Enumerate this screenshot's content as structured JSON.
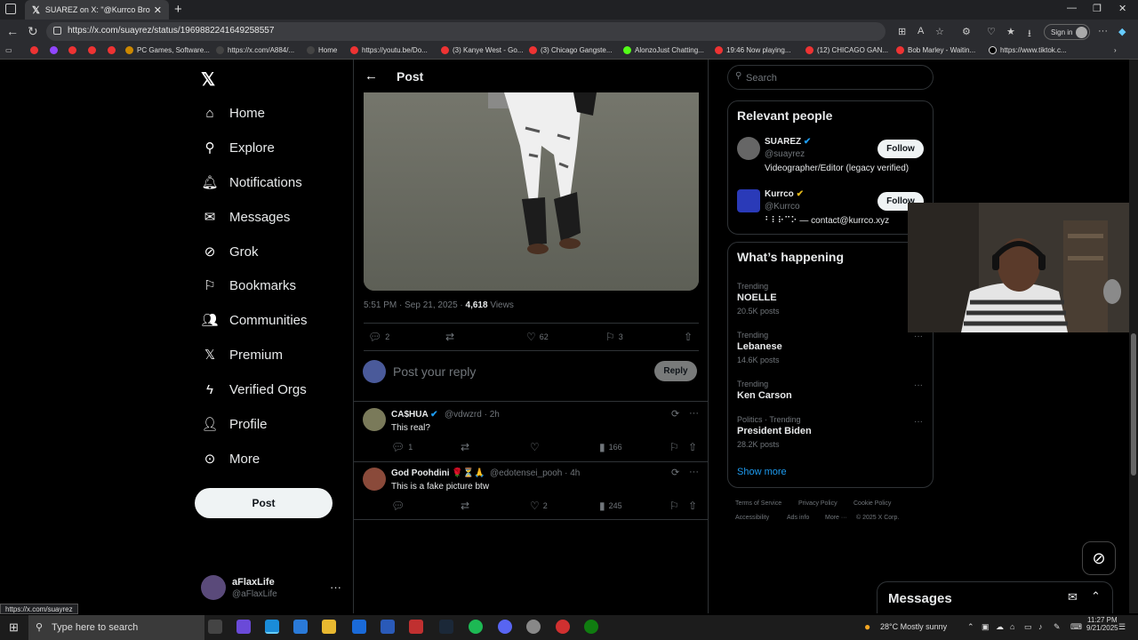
{
  "browser": {
    "tab_title": "SUAREZ on X: \"@Kurrco Bro neve",
    "url": "https://x.com/suayrez/status/1969882241649258557",
    "sign_in": "Sign in",
    "bookmarks": [
      "PC Games, Software...",
      "https://x.com/A884/...",
      "Home",
      "https://youtu.be/Do...",
      "(3) Kanye West - Go...",
      "(3) Chicago Gangste...",
      "AlonzoJust Chatting...",
      "19:46 Now playing...",
      "(12) CHICAGO GAN...",
      "Bob Marley - Waitin...",
      "https://www.tiktok.c..."
    ]
  },
  "sidebar": {
    "items": [
      {
        "label": "Home",
        "icon": "home-icon"
      },
      {
        "label": "Explore",
        "icon": "search-icon"
      },
      {
        "label": "Notifications",
        "icon": "bell-icon"
      },
      {
        "label": "Messages",
        "icon": "mail-icon"
      },
      {
        "label": "Grok",
        "icon": "grok-icon"
      },
      {
        "label": "Bookmarks",
        "icon": "bookmark-icon"
      },
      {
        "label": "Communities",
        "icon": "people-icon"
      },
      {
        "label": "Premium",
        "icon": "x-icon"
      },
      {
        "label": "Verified Orgs",
        "icon": "lightning-icon"
      },
      {
        "label": "Profile",
        "icon": "person-icon"
      },
      {
        "label": "More",
        "icon": "more-circle-icon"
      }
    ],
    "post_button": "Post",
    "account": {
      "name": "aFlaxLife",
      "handle": "@aFlaxLife"
    }
  },
  "main": {
    "header": "Post",
    "meta_time": "5:51 PM · Sep 21, 2025 · ",
    "views_count": "4,618",
    "views_label": " Views",
    "actions": {
      "replies": "2",
      "likes": "62",
      "bookmarks": "3"
    },
    "reply_placeholder": "Post your reply",
    "reply_button": "Reply",
    "replies": [
      {
        "name": "CA$HUA",
        "handle": "@vdwzrd · 2h",
        "text": "This real?",
        "replies": "1",
        "likes": "",
        "views": "166"
      },
      {
        "name": "God Poohdini 🌹⏳🙏",
        "handle": "@edotensei_pooh · 4h",
        "text": "This is a fake picture btw",
        "replies": "",
        "likes": "2",
        "views": "245"
      }
    ]
  },
  "right": {
    "search_placeholder": "Search",
    "relevant_title": "Relevant people",
    "people": [
      {
        "name": "SUAREZ",
        "handle": "@suayrez",
        "bio": "Videographer/Editor (legacy verified)",
        "follow": "Follow"
      },
      {
        "name": "Kurrco",
        "handle": "@Kurrco",
        "bio": "⠃⠇⠗⠉⠕ — contact@kurrco.xyz",
        "follow": "Follow"
      }
    ],
    "happening_title": "What’s happening",
    "trends": [
      {
        "label": "Trending",
        "name": "NOELLE",
        "count": "20.5K posts"
      },
      {
        "label": "Trending",
        "name": "Lebanese",
        "count": "14.6K posts"
      },
      {
        "label": "Trending",
        "name": "Ken Carson",
        "count": ""
      },
      {
        "label": "Politics · Trending",
        "name": "President Biden",
        "count": "28.2K posts"
      }
    ],
    "show_more": "Show more",
    "footer": [
      "Terms of Service",
      "Privacy Policy",
      "Cookie Policy",
      "Accessibility",
      "Ads info",
      "More ···",
      "© 2025 X Corp."
    ]
  },
  "messages_drawer": {
    "title": "Messages"
  },
  "status_url": "https://x.com/suayrez",
  "taskbar": {
    "search_placeholder": "Type here to search",
    "weather": "28°C  Mostly sunny",
    "time": "11:27 PM",
    "date": "9/21/2025"
  },
  "colors": {
    "accent": "#1d9bf0",
    "gold_badge": "#e2b719",
    "bg": "#000000"
  }
}
